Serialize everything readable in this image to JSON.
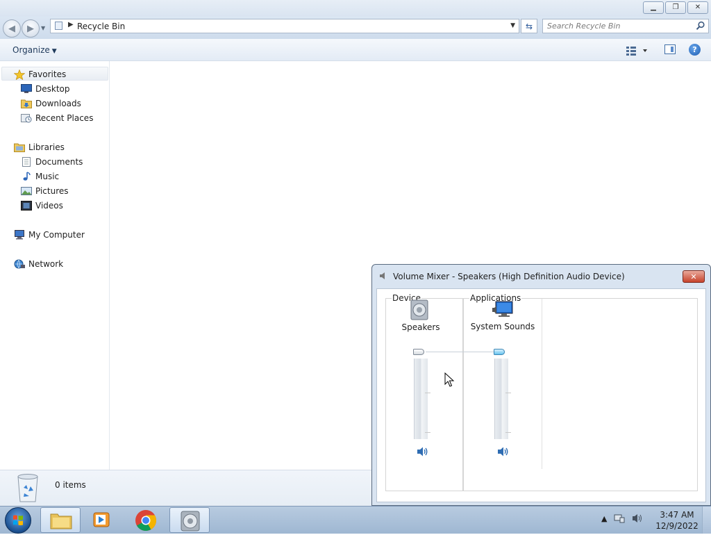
{
  "explorer": {
    "address": {
      "location": "Recycle Bin"
    },
    "search": {
      "placeholder": "Search Recycle Bin"
    },
    "command_bar": {
      "organize_label": "Organize"
    },
    "nav": {
      "favorites_label": "Favorites",
      "favorites": [
        "Desktop",
        "Downloads",
        "Recent Places"
      ],
      "libraries_label": "Libraries",
      "libraries": [
        "Documents",
        "Music",
        "Pictures",
        "Videos"
      ],
      "computer_label": "My Computer",
      "network_label": "Network"
    },
    "details": {
      "items_count": "0 items"
    }
  },
  "mixer": {
    "title": "Volume Mixer - Speakers (High Definition Audio Device)",
    "device_group_label": "Device",
    "applications_group_label": "Applications",
    "device_channel": {
      "label": "Speakers",
      "volume_level": 1.0,
      "muted": false
    },
    "app_channels": [
      {
        "label": "System Sounds",
        "volume_level": 1.0,
        "muted": false
      }
    ]
  },
  "taskbar": {
    "pinned": [
      "windows-explorer",
      "media-player",
      "chrome",
      "volume-mixer"
    ],
    "active": "volume-mixer",
    "clock": {
      "time": "3:47 AM",
      "date": "12/9/2022"
    }
  },
  "colors": {
    "accent": "#1b5cb1",
    "close_red": "#c7432b",
    "slider_thumb_active": "#66c3ee"
  }
}
